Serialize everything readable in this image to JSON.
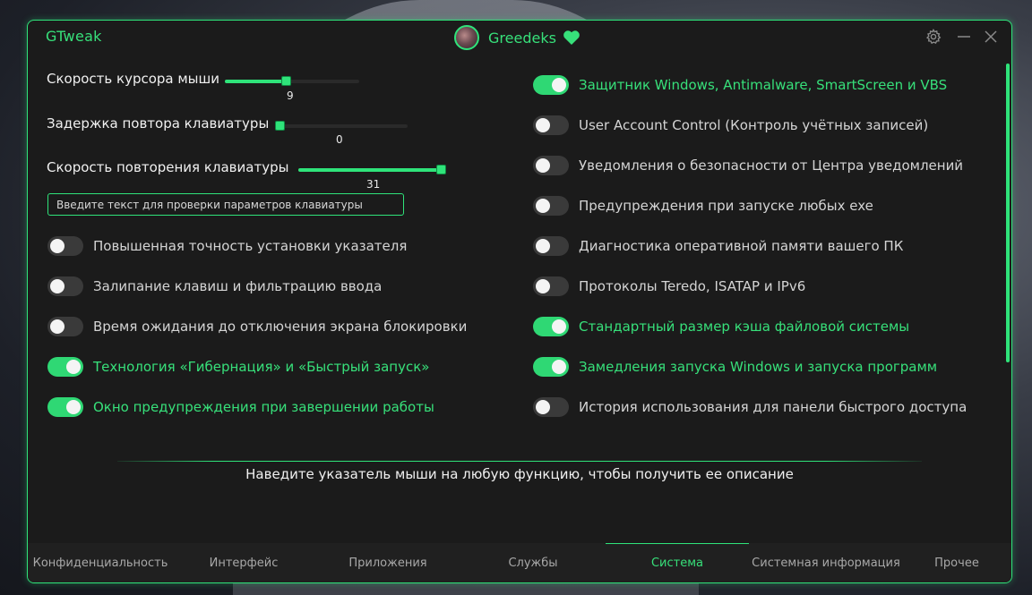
{
  "app": {
    "title": "GTweak"
  },
  "profile": {
    "username": "Greedeks",
    "avatar_icon": "avatar-image",
    "heart_icon": "heart-icon"
  },
  "window_controls": {
    "settings_icon": "gear-icon",
    "minimize_icon": "minimize-icon",
    "close_icon": "close-icon"
  },
  "colors": {
    "accent": "#2fe37a",
    "background": "#1b1b1b",
    "toggle_off": "#3a3a3a",
    "text": "#d4d4d4"
  },
  "sliders": [
    {
      "label": "Скорость курсора мыши",
      "value": "9",
      "min": 0,
      "max": 20,
      "level": 0.45
    },
    {
      "label": "Задержка повтора клавиатуры",
      "value": "0",
      "min": 0,
      "max": 3,
      "level": 0.0
    },
    {
      "label": "Скорость повторения клавиатуры",
      "value": "31",
      "min": 0,
      "max": 31,
      "level": 1.0
    }
  ],
  "keyboard_test": {
    "placeholder": "Введите текст для проверки параметров клавиатуры"
  },
  "left_toggles": [
    {
      "label": "Повышенная точность установки указателя",
      "on": false
    },
    {
      "label": "Залипание клавиш и фильтрацию ввода",
      "on": false
    },
    {
      "label": "Время ожидания до отключения экрана блокировки",
      "on": false
    },
    {
      "label": "Технология «Гибернация» и «Быстрый запуск»",
      "on": true
    },
    {
      "label": "Окно предупреждения при завершении работы",
      "on": true
    }
  ],
  "right_toggles": [
    {
      "label": "Защитник Windows, Antimalware, SmartScreen и VBS",
      "on": true
    },
    {
      "label": "User Account Control (Контроль учётных записей)",
      "on": false
    },
    {
      "label": "Уведомления о безопасности от Центра уведомлений",
      "on": false
    },
    {
      "label": "Предупреждения при запуске любых exe",
      "on": false
    },
    {
      "label": "Диагностика оперативной памяти вашего ПК",
      "on": false
    },
    {
      "label": "Протоколы Teredo, ISATAP и IPv6",
      "on": false
    },
    {
      "label": "Стандартный размер кэша файловой системы",
      "on": true
    },
    {
      "label": "Замедления запуска Windows и запуска программ",
      "on": true
    },
    {
      "label": "История использования для панели быстрого доступа",
      "on": false
    }
  ],
  "hint": "Наведите указатель мыши на любую функцию, чтобы получить ее описание",
  "tabs": [
    {
      "label": "Конфиденциальность",
      "active": false
    },
    {
      "label": "Интерфейс",
      "active": false
    },
    {
      "label": "Приложения",
      "active": false
    },
    {
      "label": "Службы",
      "active": false
    },
    {
      "label": "Система",
      "active": true
    },
    {
      "label": "Системная информация",
      "active": false
    },
    {
      "label": "Прочее",
      "active": false
    }
  ]
}
